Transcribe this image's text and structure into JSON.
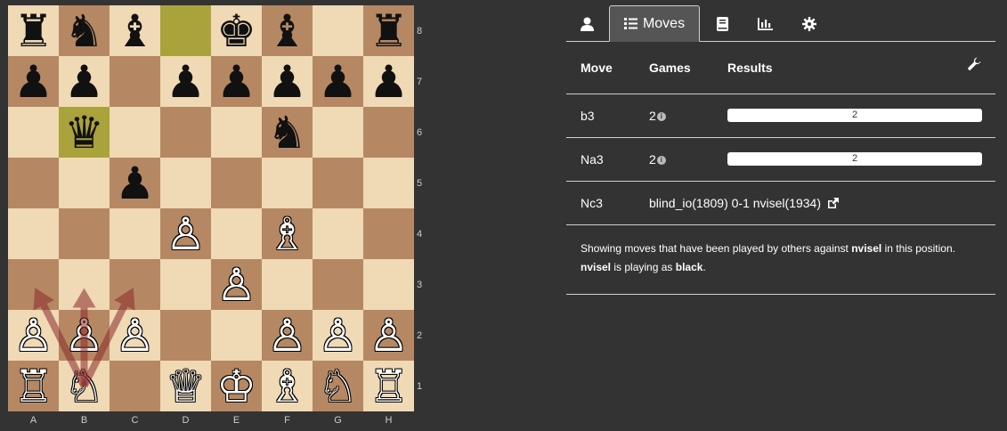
{
  "board": {
    "ranks": [
      "8",
      "7",
      "6",
      "5",
      "4",
      "3",
      "2",
      "1"
    ],
    "files": [
      "A",
      "B",
      "C",
      "D",
      "E",
      "F",
      "G",
      "H"
    ],
    "highlights": [
      "b6",
      "d8"
    ],
    "pieces": [
      {
        "sq": "a8",
        "glyph": "♜",
        "color": "b",
        "name": "black-rook"
      },
      {
        "sq": "b8",
        "glyph": "♞",
        "color": "b",
        "name": "black-knight"
      },
      {
        "sq": "c8",
        "glyph": "♝",
        "color": "b",
        "name": "black-bishop"
      },
      {
        "sq": "e8",
        "glyph": "♚",
        "color": "b",
        "name": "black-king"
      },
      {
        "sq": "f8",
        "glyph": "♝",
        "color": "b",
        "name": "black-bishop"
      },
      {
        "sq": "h8",
        "glyph": "♜",
        "color": "b",
        "name": "black-rook"
      },
      {
        "sq": "a7",
        "glyph": "♟",
        "color": "b",
        "name": "black-pawn"
      },
      {
        "sq": "b7",
        "glyph": "♟",
        "color": "b",
        "name": "black-pawn"
      },
      {
        "sq": "d7",
        "glyph": "♟",
        "color": "b",
        "name": "black-pawn"
      },
      {
        "sq": "e7",
        "glyph": "♟",
        "color": "b",
        "name": "black-pawn"
      },
      {
        "sq": "f7",
        "glyph": "♟",
        "color": "b",
        "name": "black-pawn"
      },
      {
        "sq": "g7",
        "glyph": "♟",
        "color": "b",
        "name": "black-pawn"
      },
      {
        "sq": "h7",
        "glyph": "♟",
        "color": "b",
        "name": "black-pawn"
      },
      {
        "sq": "b6",
        "glyph": "♛",
        "color": "b",
        "name": "black-queen"
      },
      {
        "sq": "f6",
        "glyph": "♞",
        "color": "b",
        "name": "black-knight"
      },
      {
        "sq": "c5",
        "glyph": "♟",
        "color": "b",
        "name": "black-pawn"
      },
      {
        "sq": "d4",
        "glyph": "♙",
        "color": "w",
        "name": "white-pawn"
      },
      {
        "sq": "f4",
        "glyph": "♗",
        "color": "w",
        "name": "white-bishop"
      },
      {
        "sq": "e3",
        "glyph": "♙",
        "color": "w",
        "name": "white-pawn"
      },
      {
        "sq": "a2",
        "glyph": "♙",
        "color": "w",
        "name": "white-pawn"
      },
      {
        "sq": "b2",
        "glyph": "♙",
        "color": "w",
        "name": "white-pawn"
      },
      {
        "sq": "c2",
        "glyph": "♙",
        "color": "w",
        "name": "white-pawn"
      },
      {
        "sq": "f2",
        "glyph": "♙",
        "color": "w",
        "name": "white-pawn"
      },
      {
        "sq": "g2",
        "glyph": "♙",
        "color": "w",
        "name": "white-pawn"
      },
      {
        "sq": "h2",
        "glyph": "♙",
        "color": "w",
        "name": "white-pawn"
      },
      {
        "sq": "a1",
        "glyph": "♖",
        "color": "w",
        "name": "white-rook"
      },
      {
        "sq": "b1",
        "glyph": "♘",
        "color": "w",
        "name": "white-knight"
      },
      {
        "sq": "d1",
        "glyph": "♕",
        "color": "w",
        "name": "white-queen"
      },
      {
        "sq": "e1",
        "glyph": "♔",
        "color": "w",
        "name": "white-king"
      },
      {
        "sq": "f1",
        "glyph": "♗",
        "color": "w",
        "name": "white-bishop"
      },
      {
        "sq": "g1",
        "glyph": "♘",
        "color": "w",
        "name": "white-knight"
      },
      {
        "sq": "h1",
        "glyph": "♖",
        "color": "w",
        "name": "white-rook"
      }
    ],
    "arrows": [
      {
        "from": "b1",
        "to": "a3"
      },
      {
        "from": "b1",
        "to": "b3"
      },
      {
        "from": "b1",
        "to": "c3"
      }
    ],
    "arrow_color": "#8b2a2a"
  },
  "tabs": [
    {
      "icon": "user-icon",
      "label": ""
    },
    {
      "icon": "list-icon",
      "label": "Moves",
      "active": true
    },
    {
      "icon": "book-icon",
      "label": ""
    },
    {
      "icon": "bar-chart-icon",
      "label": ""
    },
    {
      "icon": "gear-icon",
      "label": ""
    }
  ],
  "table": {
    "headers": {
      "move": "Move",
      "games": "Games",
      "results": "Results"
    },
    "rows": [
      {
        "move": "b3",
        "games": "2",
        "result": "2"
      },
      {
        "move": "Na3",
        "games": "2",
        "result": "2"
      },
      {
        "move": "Nc3",
        "game_link": "blind_io(1809) 0-1 nvisel(1934)"
      }
    ]
  },
  "note": {
    "line1_prefix": "Showing moves that have been played by others against ",
    "player": "nvisel",
    "line1_suffix": " in this position.",
    "line2_player": "nvisel",
    "line2_mid": " is playing as ",
    "line2_color": "black",
    "line2_end": "."
  }
}
